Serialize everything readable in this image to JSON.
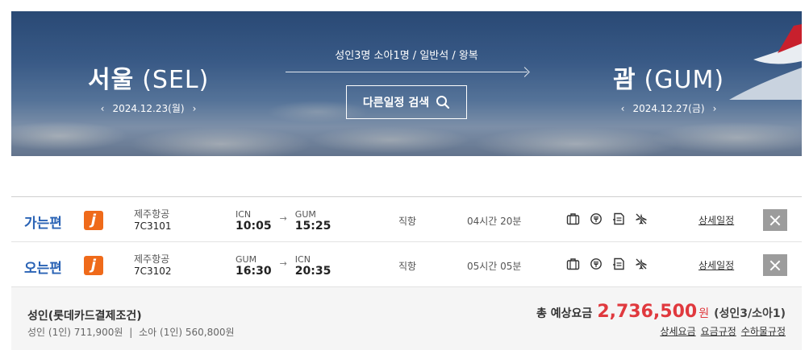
{
  "hero": {
    "departure": {
      "city": "서울",
      "code": "(SEL)",
      "date": "2024.12.23(월)",
      "prev": "‹",
      "next": "›"
    },
    "arrival": {
      "city": "괌",
      "code": "(GUM)",
      "date": "2024.12.27(금)",
      "prev": "‹",
      "next": "›"
    },
    "passengers": "성인3명 소아1명 / 일반석 / 왕복",
    "search_button": "다른일정 검색"
  },
  "itineraries": [
    {
      "direction": "가는편",
      "airline": "제주항공",
      "flight_no": "7C3101",
      "from_code": "ICN",
      "from_time": "10:05",
      "to_code": "GUM",
      "to_time": "15:25",
      "arrow": "→",
      "type": "직항",
      "duration": "04시간 20분",
      "detail_link": "상세일정"
    },
    {
      "direction": "오는편",
      "airline": "제주항공",
      "flight_no": "7C3102",
      "from_code": "GUM",
      "from_time": "16:30",
      "to_code": "ICN",
      "to_time": "20:35",
      "arrow": "→",
      "type": "직항",
      "duration": "05시간 05분",
      "detail_link": "상세일정"
    }
  ],
  "airline_logo_letter": "j",
  "summary": {
    "title": "성인(롯데카드결제조건)",
    "adult": "성인 (1인)  711,900원",
    "separator": "|",
    "child": "소아 (1인)  560,800원",
    "total_label": "총 예상요금",
    "total_amount": "2,736,500",
    "currency": "원",
    "pax_breakdown": "(성인3/소아1)",
    "links": [
      "상세요금",
      "요금규정",
      "수하물규정"
    ]
  },
  "colors": {
    "direction": "#2a63b5",
    "price": "#e0393e",
    "logo": "#ef6a1a"
  }
}
